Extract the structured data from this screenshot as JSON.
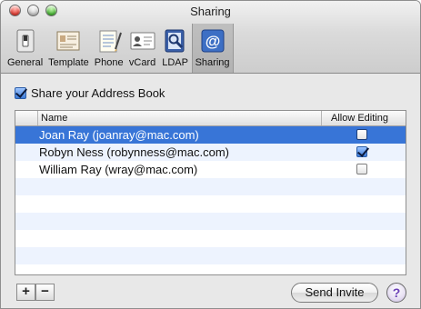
{
  "window": {
    "title": "Sharing"
  },
  "toolbar": {
    "items": [
      {
        "label": "General",
        "icon": "switch-icon"
      },
      {
        "label": "Template",
        "icon": "card-template-icon"
      },
      {
        "label": "Phone",
        "icon": "phone-notepad-icon"
      },
      {
        "label": "vCard",
        "icon": "vcard-icon"
      },
      {
        "label": "LDAP",
        "icon": "ldap-directory-icon"
      },
      {
        "label": "Sharing",
        "icon": "at-sign-icon",
        "selected": true
      }
    ]
  },
  "share": {
    "label": "Share your Address Book",
    "checked": true
  },
  "table": {
    "columns": [
      "Name",
      "Allow Editing"
    ],
    "rows": [
      {
        "name": "Joan Ray (joanray@mac.com)",
        "allow_editing": false,
        "selected": true
      },
      {
        "name": "Robyn Ness (robynness@mac.com)",
        "allow_editing": true,
        "selected": false
      },
      {
        "name": "William Ray (wray@mac.com)",
        "allow_editing": false,
        "selected": false
      }
    ]
  },
  "buttons": {
    "add": "+",
    "remove": "−",
    "send_invite": "Send Invite",
    "help": "?"
  },
  "colors": {
    "selection": "#3875d7",
    "stripe": "#edf3fe"
  }
}
